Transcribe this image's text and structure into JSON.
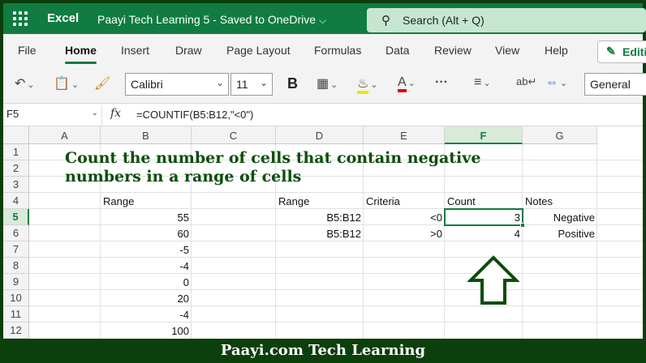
{
  "titlebar": {
    "app_name": "Excel",
    "doc_name": "Paayi Tech Learning 5  -  Saved to OneDrive",
    "search_placeholder": "Search (Alt + Q)"
  },
  "ribbon": {
    "tabs": [
      "File",
      "Home",
      "Insert",
      "Draw",
      "Page Layout",
      "Formulas",
      "Data",
      "Review",
      "View",
      "Help"
    ],
    "active_tab": "Home",
    "edit_label": "Editi",
    "font_name": "Calibri",
    "font_size": "11",
    "bold_label": "B",
    "font_color_label": "A",
    "more_label": "···",
    "number_format": "General"
  },
  "formula_bar": {
    "name_box": "F5",
    "fx_label": "fx",
    "formula": "=COUNTIF(B5:B12,\"<0\")"
  },
  "sheet": {
    "columns": [
      "A",
      "B",
      "C",
      "D",
      "E",
      "F",
      "G"
    ],
    "rows": [
      "1",
      "2",
      "3",
      "4",
      "5",
      "6",
      "7",
      "8",
      "9",
      "10",
      "11",
      "12"
    ],
    "selected_column": "F",
    "selected_row": "5",
    "heading_line1": "Count the number of cells that contain negative",
    "heading_line2": "numbers in a range of cells",
    "b4": "Range",
    "b_values": [
      "55",
      "60",
      "-5",
      "-4",
      "0",
      "20",
      "-4",
      "100"
    ],
    "d4": "Range",
    "e4": "Criteria",
    "f4": "Count",
    "g4": "Notes",
    "d5": "B5:B12",
    "e5": "<0",
    "f5": "3",
    "g5": "Negative",
    "d6": "B5:B12",
    "e6": ">0",
    "f6": "4",
    "g6": "Positive"
  },
  "footer": {
    "text": "Paayi.com Tech Learning"
  },
  "colors": {
    "excel_green": "#107c41",
    "frame_green": "#0b3f0b",
    "heading_green": "#0b4d0b"
  }
}
